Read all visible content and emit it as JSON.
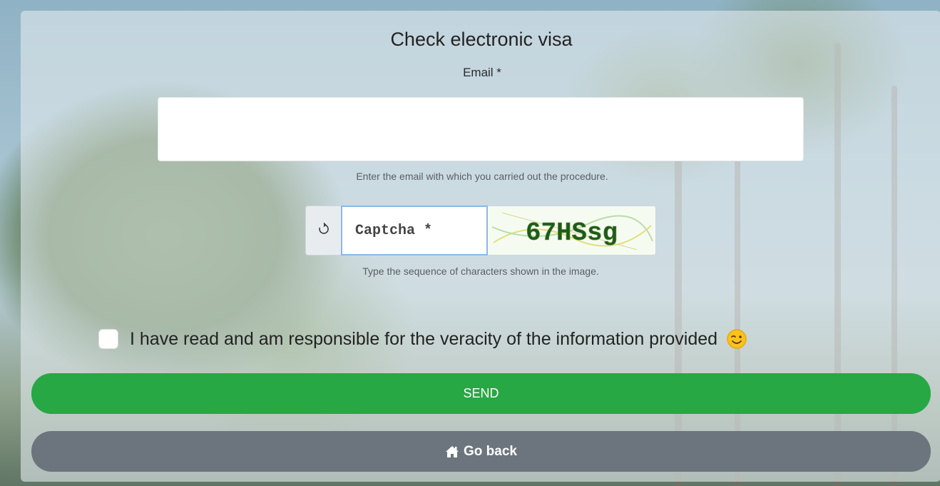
{
  "form": {
    "title": "Check electronic visa",
    "email": {
      "label": "Email *",
      "value": "",
      "help": "Enter the email with which you carried out the procedure."
    },
    "captcha": {
      "placeholder": "Captcha *",
      "image_text": "67HSsg",
      "help": "Type the sequence of characters shown in the image.",
      "refresh_icon": "refresh-icon"
    },
    "consent": {
      "label": "I have read and am responsible for the veracity of the information provided",
      "checked": false,
      "emoji_icon": "wink-emoji-icon"
    },
    "send_label": "SEND",
    "back_label": "Go back",
    "back_icon": "home-icon"
  },
  "colors": {
    "send": "#28a745",
    "back": "#6c757d",
    "captcha_text": "#1f5a1f"
  }
}
